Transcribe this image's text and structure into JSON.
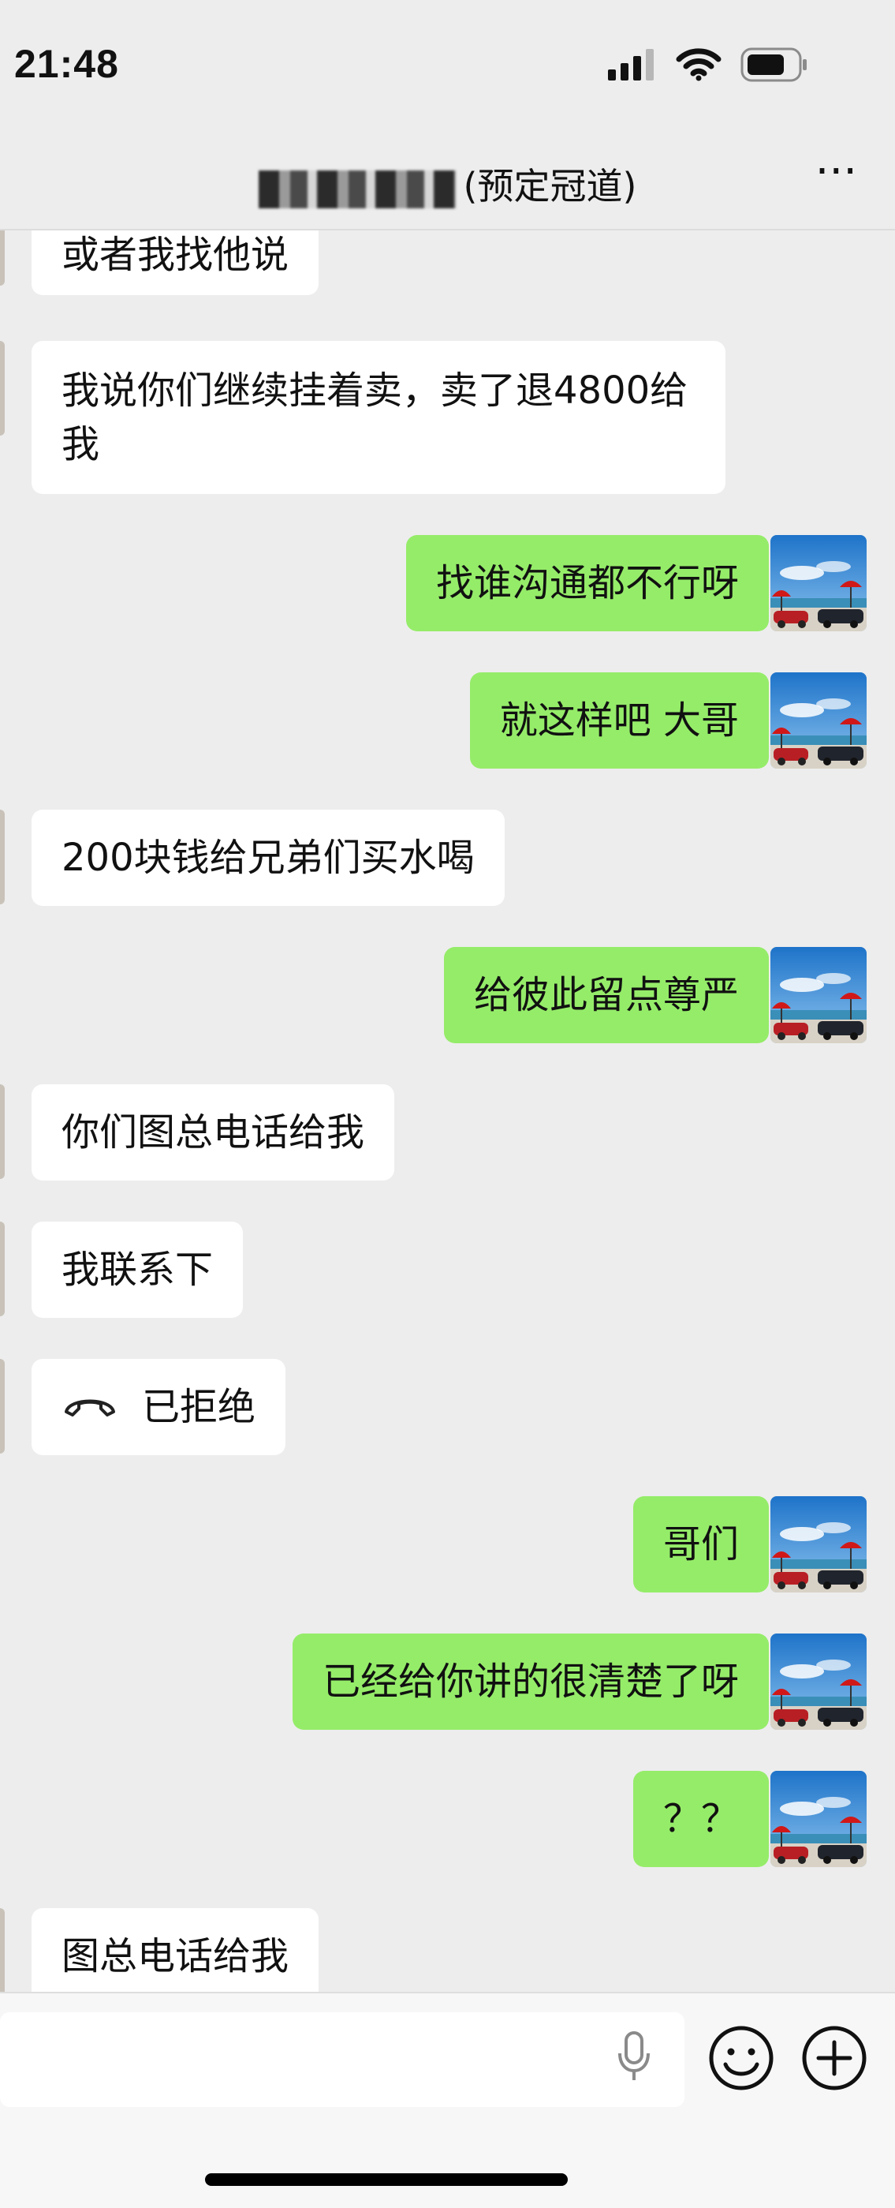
{
  "status_bar": {
    "time": "21:48"
  },
  "header": {
    "title": "(预定冠道)",
    "more_label": "···"
  },
  "messages": [
    {
      "side": "in",
      "text": "或者我找他说"
    },
    {
      "side": "in",
      "text": "我说你们继续挂着卖，卖了退4800给我"
    },
    {
      "side": "out",
      "text": "找谁沟通都不行呀"
    },
    {
      "side": "out",
      "text": "就这样吧 大哥"
    },
    {
      "side": "in",
      "text": "200块钱给兄弟们买水喝"
    },
    {
      "side": "out",
      "text": "给彼此留点尊严"
    },
    {
      "side": "in",
      "text": "你们图总电话给我"
    },
    {
      "side": "in",
      "text": "我联系下"
    },
    {
      "side": "in",
      "text": "已拒绝",
      "icon": "phone-declined-icon"
    },
    {
      "side": "out",
      "text": "哥们"
    },
    {
      "side": "out",
      "text": "已经给你讲的很清楚了呀"
    },
    {
      "side": "out",
      "text": "？？"
    },
    {
      "side": "in",
      "text": "图总电话给我"
    }
  ],
  "icons": {
    "signal": "signal-icon",
    "wifi": "wifi-icon",
    "battery": "battery-icon",
    "microphone": "microphone-icon",
    "emoji": "emoji-icon",
    "plus": "plus-icon",
    "avatar": "avatar-image"
  },
  "colors": {
    "outgoing_bubble": "#95ec69",
    "incoming_bubble": "#ffffff",
    "background": "#ededed"
  }
}
